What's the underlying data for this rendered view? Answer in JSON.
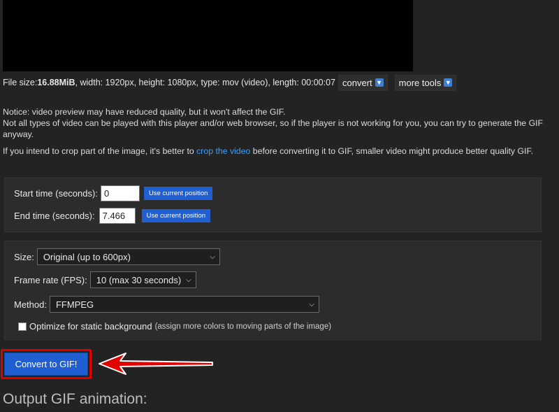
{
  "file_info": {
    "prefix": "File size: ",
    "size": "16.88MiB",
    "details": ", width: 1920px, height: 1080px, type: mov (video), length: 00:00:07",
    "convert_label": "convert",
    "more_tools_label": "more tools"
  },
  "notice": {
    "line1": "Notice: video preview may have reduced quality, but it won't affect the GIF.",
    "line2": "Not all types of video can be played with this player and/or web browser, so if the player is not working for you, you can try to generate the GIF anyway.",
    "crop_before": "If you intend to crop part of the image, it's better to ",
    "crop_link": "crop the video",
    "crop_after": " before converting it to GIF, smaller video might produce better quality GIF."
  },
  "time": {
    "start_label": "Start time (seconds):",
    "start_value": "0",
    "end_label": "End time (seconds):",
    "end_value": "7.466",
    "use_current_label": "Use current position"
  },
  "options": {
    "size_label": "Size:",
    "size_value": "Original (up to 600px)",
    "fps_label": "Frame rate (FPS):",
    "fps_value": "10 (max 30 seconds)",
    "method_label": "Method:",
    "method_value": "FFMPEG",
    "optimize_label": "Optimize for static background",
    "optimize_hint": "(assign more colors to moving parts of the image)",
    "optimize_checked": false
  },
  "convert_button": "Convert to GIF!",
  "output_title": "Output GIF animation:",
  "colors": {
    "accent": "#1f5fd1",
    "highlight": "#e10000",
    "link": "#3aa0ff"
  }
}
